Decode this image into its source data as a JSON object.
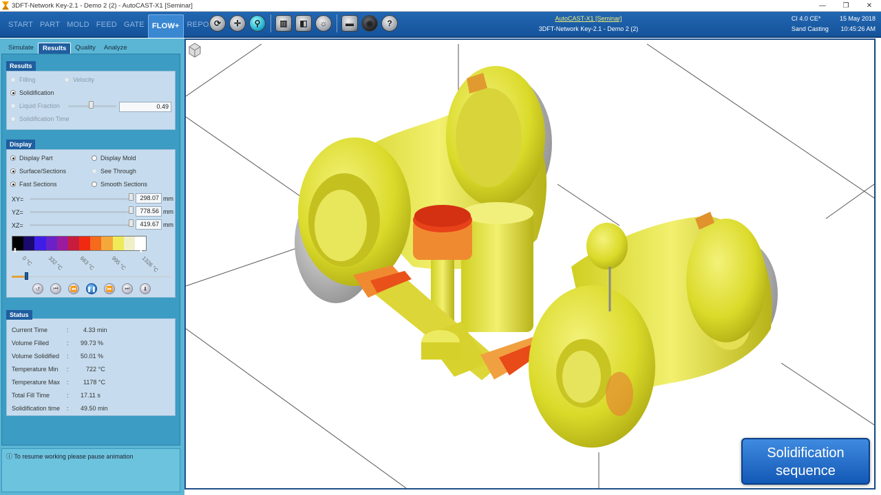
{
  "window": {
    "title": "3DFT-Network Key-2.1 - Demo 2 (2) - AutoCAST-X1 [Seminar]",
    "controls": [
      "—",
      "❐",
      "✕"
    ]
  },
  "menu": {
    "items": [
      "START",
      "PART",
      "MOLD",
      "FEED",
      "GATE",
      "FLOW+",
      "REPORT"
    ],
    "active": "FLOW+"
  },
  "toolbar": {
    "icons": [
      "rotate-icon",
      "pan-icon",
      "zoom-icon",
      "ortho-view-icon",
      "section-view-icon",
      "lighting-icon",
      "measure-icon",
      "camera-icon",
      "help-icon"
    ]
  },
  "header_info": {
    "link": "AutoCAST-X1 [Seminar]",
    "project": "3DFT-Network Key-2.1 - Demo 2 (2)",
    "material": "CI 4.0 CE*",
    "date": "15 May 2018",
    "process": "Sand Casting",
    "time": "10:45:26 AM"
  },
  "subtabs": [
    "Simulate",
    "Results",
    "Quality",
    "Analyze"
  ],
  "results": {
    "header": "Results",
    "filling": "Filling",
    "velocity": "Velocity",
    "solidification": "Solidification",
    "liquid_fraction": "Liquid Fraction",
    "liquid_fraction_value": "0.49",
    "solidification_time": "Solidification Time"
  },
  "display": {
    "header": "Display",
    "display_part": "Display Part",
    "display_mold": "Display Mold",
    "surface_sections": "Surface/Sections",
    "see_through": "See Through",
    "fast_sections": "Fast Sections",
    "smooth_sections": "Smooth Sections",
    "xy_label": "XY=",
    "xy_value": "298.07",
    "yz_label": "YZ=",
    "yz_value": "778.56",
    "xz_label": "XZ=",
    "xz_value": "419.67",
    "unit": "mm"
  },
  "colorbar": {
    "colors": [
      "#000000",
      "#1a0a6e",
      "#3d1ee8",
      "#6a22c8",
      "#9a1c9c",
      "#c81c3c",
      "#f02a10",
      "#f56a1c",
      "#f5a83a",
      "#eeea58",
      "#f0f0c8",
      "#ffffff"
    ],
    "labels": [
      "0 °C",
      "332 °C",
      "663 °C",
      "995 °C",
      "1326 °C"
    ]
  },
  "animation": {
    "progress": 0.09
  },
  "status": {
    "header": "Status",
    "rows": [
      {
        "k": "Current Time",
        "v": "4.33 min"
      },
      {
        "k": "Volume Filled",
        "v": "99.73 %"
      },
      {
        "k": "Volume Solidified",
        "v": "50.01 %"
      },
      {
        "k": "Temperature Min",
        "v": "722 °C"
      },
      {
        "k": "Temperature Max",
        "v": "1178 °C"
      },
      {
        "k": "Total Fill Time",
        "v": "17.11 s"
      },
      {
        "k": "Solidification time",
        "v": "49.50 min"
      }
    ]
  },
  "info_message": "To resume working please pause animation",
  "caption": {
    "line1": "Solidification",
    "line2": "sequence"
  }
}
